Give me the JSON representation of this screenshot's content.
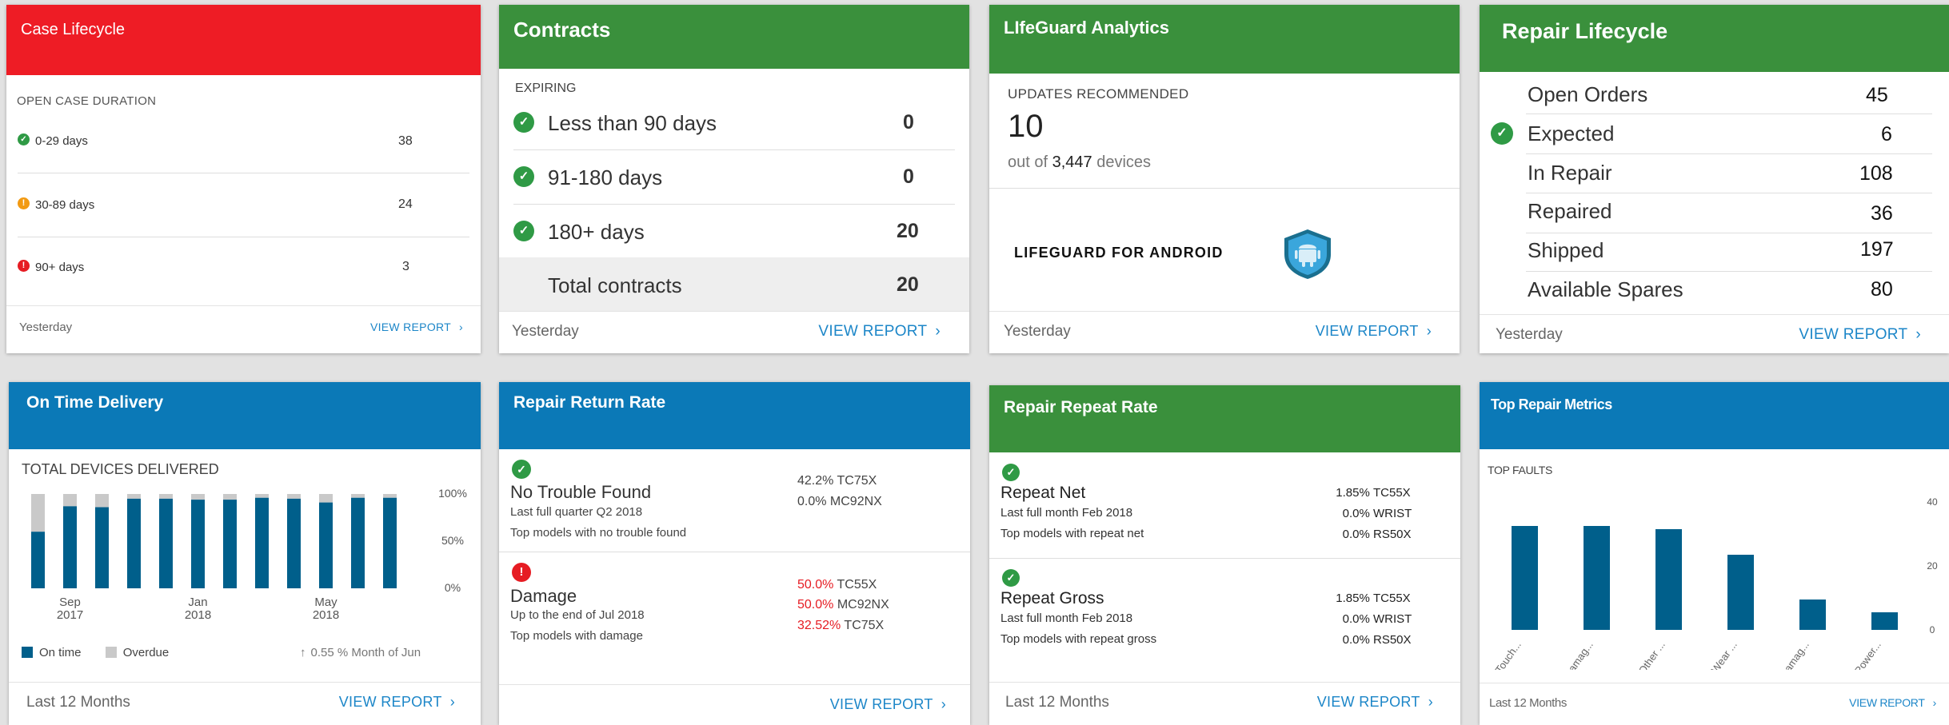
{
  "case_lifecycle": {
    "title": "Case Lifecycle",
    "subtitle": "OPEN CASE DURATION",
    "rows": [
      {
        "label": "0-29 days",
        "value": "38",
        "status": "green"
      },
      {
        "label": "30-89 days",
        "value": "24",
        "status": "orange"
      },
      {
        "label": "90+ days",
        "value": "3",
        "status": "red"
      }
    ],
    "footer": "Yesterday",
    "link": "VIEW REPORT"
  },
  "contracts": {
    "title": "Contracts",
    "subtitle": "EXPIRING",
    "rows": [
      {
        "label": "Less than 90 days",
        "value": "0"
      },
      {
        "label": "91-180 days",
        "value": "0"
      },
      {
        "label": "180+ days",
        "value": "20"
      }
    ],
    "total_label": "Total contracts",
    "total_value": "20",
    "footer": "Yesterday",
    "link": "VIEW REPORT"
  },
  "lifeguard": {
    "title": "LIfeGuard Analytics",
    "subtitle": "UPDATES RECOMMENDED",
    "count": "10",
    "out_of_prefix": "out of",
    "out_of_count": "3,447",
    "out_of_suffix": "devices",
    "android_label": "LIFEGUARD FOR ANDROID",
    "footer": "Yesterday",
    "link": "VIEW REPORT"
  },
  "repair_lifecycle": {
    "title": "Repair Lifecycle",
    "rows": [
      {
        "label": "Open Orders",
        "value": "45"
      },
      {
        "label": "Expected",
        "value": "6"
      },
      {
        "label": "In Repair",
        "value": "108"
      },
      {
        "label": "Repaired",
        "value": "36"
      },
      {
        "label": "Shipped",
        "value": "197"
      },
      {
        "label": "Available Spares",
        "value": "80"
      }
    ],
    "footer": "Yesterday",
    "link": "VIEW REPORT"
  },
  "on_time": {
    "title": "On Time Delivery",
    "subtitle": "TOTAL DEVICES DELIVERED",
    "legend_on_time": "On time",
    "legend_overdue": "Overdue",
    "trend": "0.55 % Month of Jun",
    "footer": "Last 12 Months",
    "link": "VIEW REPORT",
    "colors": {
      "on_time": "#005f8b",
      "overdue": "#c9c9c9"
    }
  },
  "repair_return": {
    "title": "Repair Return Rate",
    "section1": {
      "label": "No Trouble Found",
      "line1": "Last full quarter Q2 2018",
      "line2": "Top models with no trouble found",
      "models": [
        {
          "pct": "42.2%",
          "model": "TC75X"
        },
        {
          "pct": "0.0%",
          "model": "MC92NX"
        }
      ]
    },
    "section2": {
      "label": "Damage",
      "line1": "Up to the end of Jul 2018",
      "line2": "Top models with damage",
      "models": [
        {
          "pct": "50.0%",
          "model": "TC55X"
        },
        {
          "pct": "50.0%",
          "model": "MC92NX"
        },
        {
          "pct": "32.52%",
          "model": "TC75X"
        }
      ]
    },
    "link": "VIEW REPORT"
  },
  "repair_repeat": {
    "title": "Repair Repeat Rate",
    "section1": {
      "label": "Repeat Net",
      "line1": "Last full month Feb 2018",
      "line2": "Top models with repeat net",
      "models": [
        {
          "pct": "1.85%",
          "model": "TC55X"
        },
        {
          "pct": "0.0%",
          "model": "WRIST"
        },
        {
          "pct": "0.0%",
          "model": "RS50X"
        }
      ]
    },
    "section2": {
      "label": "Repeat Gross",
      "line1": "Last full month Feb 2018",
      "line2": "Top models with repeat gross",
      "models": [
        {
          "pct": "1.85%",
          "model": "TC55X"
        },
        {
          "pct": "0.0%",
          "model": "WRIST"
        },
        {
          "pct": "0.0%",
          "model": "RS50X"
        }
      ]
    },
    "footer": "Last 12 Months",
    "link": "VIEW REPORT"
  },
  "top_repair": {
    "title": "Top Repair Metrics",
    "subtitle": "TOP FAULTS",
    "footer": "Last 12 Months",
    "link": "VIEW REPORT"
  },
  "chart_data": [
    {
      "type": "bar",
      "stacked": true,
      "series": [
        {
          "name": "On time",
          "values": [
            60,
            87,
            86,
            95,
            95,
            94,
            94,
            96,
            95,
            91,
            96,
            96
          ]
        },
        {
          "name": "Overdue",
          "values": [
            40,
            13,
            14,
            5,
            5,
            6,
            6,
            4,
            5,
            9,
            4,
            4
          ]
        }
      ],
      "x_ticks": [
        {
          "index": 1,
          "label1": "Sep",
          "label2": "2017"
        },
        {
          "index": 5,
          "label1": "Jan",
          "label2": "2018"
        },
        {
          "index": 9,
          "label1": "May",
          "label2": "2018"
        }
      ],
      "yticks": [
        "100%",
        "50%",
        "0%"
      ],
      "ylim": [
        0,
        100
      ],
      "legend": "bottom-left"
    },
    {
      "type": "bar",
      "categories": [
        "Touch...",
        "Damag...",
        "Other ...",
        "Wear ...",
        "Damag...",
        "Power..."
      ],
      "values": [
        32.5,
        32.5,
        31.5,
        23.5,
        9.5,
        5.5
      ],
      "yticks": [
        "40",
        "20",
        "0"
      ],
      "ylim": [
        0,
        40
      ]
    }
  ]
}
